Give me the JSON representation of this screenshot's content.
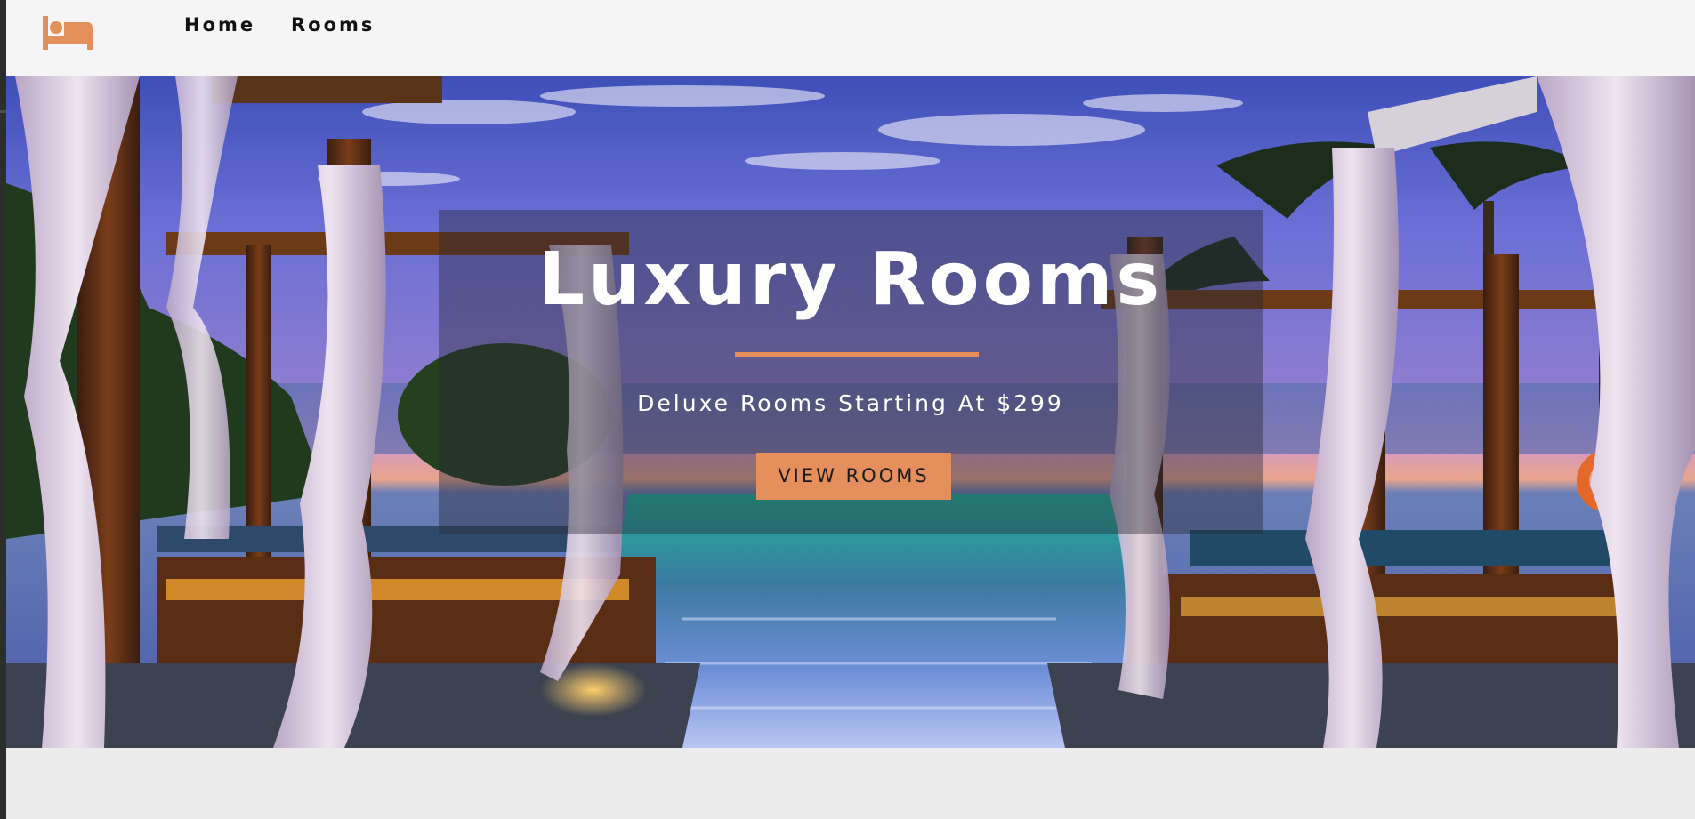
{
  "colors": {
    "accent": "#e48f5c",
    "navbar_bg": "#f5f5f5",
    "page_bg": "#ececec",
    "nav_text": "#111111",
    "banner_text": "#ffffff"
  },
  "navbar": {
    "logo_icon": "bed-icon",
    "links": [
      {
        "label": "Home"
      },
      {
        "label": "Rooms"
      }
    ]
  },
  "hero": {
    "background": "resort-cabanas-infinity-pool-photo",
    "title": "Luxury Rooms",
    "subtitle": "Deluxe Rooms Starting At $299",
    "button_label": "VIEW ROOMS"
  }
}
